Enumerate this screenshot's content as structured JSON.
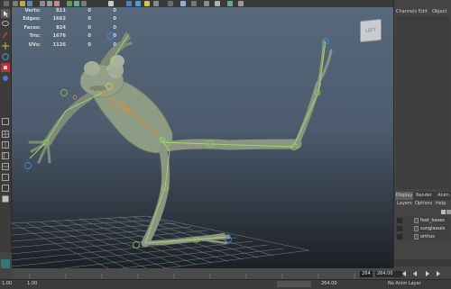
{
  "hud": {
    "rows": [
      {
        "label": "Verts:",
        "v1": "811",
        "v2": "0",
        "v3": "0"
      },
      {
        "label": "Edges:",
        "v1": "1662",
        "v2": "0",
        "v3": "0"
      },
      {
        "label": "Faces:",
        "v1": "824",
        "v2": "0",
        "v3": "0"
      },
      {
        "label": "Tris:",
        "v1": "1676",
        "v2": "0",
        "v3": "0"
      },
      {
        "label": "UVs:",
        "v1": "1126",
        "v2": "0",
        "v3": "0"
      }
    ]
  },
  "viewcube": {
    "label": "LEFT"
  },
  "channel_box": {
    "menu": [
      "Channels",
      "Edit",
      "Object"
    ]
  },
  "layer_editor": {
    "tabs": [
      "Display",
      "Render",
      "Anim"
    ],
    "active_tab": "Display",
    "menu": [
      "Layers",
      "Options",
      "Help"
    ],
    "layers": [
      {
        "name": "feet_bases",
        "swatch": "#555555",
        "visible": true
      },
      {
        "name": "sunglasses",
        "swatch": "#555555",
        "visible": true
      },
      {
        "name": "orthos",
        "swatch": "#555555",
        "visible": true
      }
    ]
  },
  "timeline": {
    "tick_label": "264",
    "current_frame": "264.00"
  },
  "range_slider": {
    "start_label": "1.00",
    "start_value": "1.00",
    "end_value": "264.00",
    "right_label": "No Anim Layer"
  },
  "colors": {
    "viewport_top": "#58687b",
    "viewport_bottom": "#1c2026",
    "skin": "#8c9a82",
    "joint_green": "#8fd15a",
    "joint_blue": "#3f8be0",
    "bone_orange": "#e48a2e"
  }
}
